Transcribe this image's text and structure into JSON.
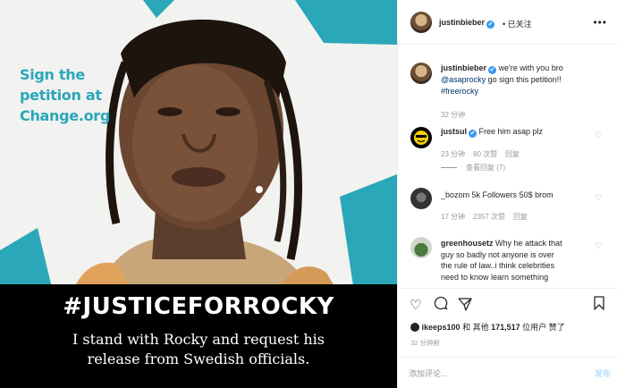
{
  "image": {
    "petition_text": "Sign the petition at Change.org",
    "hashtag": "#JUSTICEFORROCKY",
    "statement_line1": "I stand with Rocky and request his",
    "statement_line2": "release from Swedish officials.",
    "accent_color": "#2aa7b8"
  },
  "header": {
    "username": "justinbieber",
    "verified": "✔",
    "separator": "•",
    "follow_status": "已关注",
    "more_icon": "more-icon"
  },
  "caption": {
    "username": "justinbieber",
    "text_part1": "we're with you bro",
    "mention": "@asaprocky",
    "text_part2": "go sign this petition!!",
    "hashtag": "#freerocky",
    "time": "32 分钟"
  },
  "comments": [
    {
      "username": "justsul",
      "text": "Free him asap plz",
      "time": "23 分钟",
      "likes": "80 次赞",
      "reply": "回复",
      "view_replies": "查看回复 (7)"
    },
    {
      "username": "_bozom",
      "text": "5k Followers 50$ brom",
      "time": "17 分钟",
      "likes": "2357 次赞",
      "reply": "回复"
    },
    {
      "username": "greenhousetz",
      "text_line1": "Why he attack that",
      "text_line2": "guy so badly not anyone is over",
      "text_line3": "the rule of law..i think celebrities",
      "text_line4": "need to know learn something"
    }
  ],
  "actions": {
    "liked_by_prefix": "ikeeps100",
    "liked_by_mid": "和 其他",
    "likes_count": "171,517",
    "liked_by_suffix": "位用户 赞了",
    "timestamp": "32 分钟前"
  },
  "comment_box": {
    "placeholder": "添加评论...",
    "post_label": "发布"
  }
}
